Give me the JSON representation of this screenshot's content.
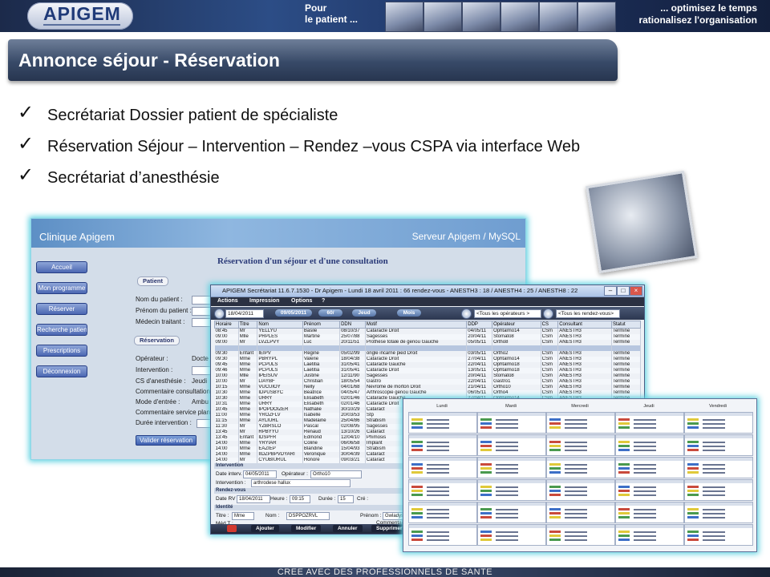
{
  "banner": {
    "logo_text": "APIGEM",
    "left_text": "Pour\nle patient ...",
    "right_text": "... optimisez le temps\nrationalisez l'organisation"
  },
  "slide": {
    "title": "Annonce séjour - Réservation",
    "bullets": [
      "Secrétariat  Dossier patient de spécialiste",
      "Réservation Séjour – Intervention – Rendez –vous CSPA via interface Web",
      "Secrétariat  d’anesthésie"
    ],
    "check_glyph": "✓"
  },
  "web_interface": {
    "clinic": "Clinique Apigem",
    "server": "Serveur Apigem / MySQL",
    "nav": [
      "Accueil",
      "Mon programme",
      "Réserver",
      "Recherche patient",
      "Prescriptions",
      "Déconnexion"
    ],
    "panel_title": "Réservation d'un séjour et d'une consultation",
    "section_patient": "Patient",
    "labels_patient": [
      "Nom du patient :",
      "Prénom du patient :",
      "Médecin traitant :"
    ],
    "section_reservation": "Réservation",
    "labels_reservation": [
      "Opérateur :",
      "Intervention :",
      "CS d'anesthésie :",
      "Commentaire consultation",
      "Mode d'entrée :",
      "Commentaire service planni",
      "Durée intervention :"
    ],
    "values": [
      "Docte",
      "Jeudi",
      "Ambu"
    ],
    "validate_button": "Valider réservation"
  },
  "secretariat": {
    "title": "APIGEM Secrétariat 11.6.7.1530 - Dr Apigem - Lundi 18 avril 2011 : 66 rendez-vous - ANESTH3 : 18 / ANESTH4 : 25 / ANESTH8 : 22",
    "window_controls": [
      "–",
      "□",
      "×"
    ],
    "menu": [
      "Actions",
      "Impression",
      "Options",
      "?"
    ],
    "toolbar": {
      "date_from": "18/04/2011",
      "date_to": "09/05/2011",
      "btn_1": "60/",
      "btn_2": "Jeud",
      "btn_3": "Mois",
      "operateurs": "<Tous les opérateurs >",
      "rendezvous": "<Tous les rendez-vous>"
    },
    "columns": [
      "Horaire",
      "Titre",
      "Nom",
      "Prénom",
      "DDN",
      "Motif",
      "DDP",
      "Opérateur",
      "CS",
      "Consultant",
      "Statut"
    ],
    "rows": [
      [
        "08:45",
        "Mr",
        "YELLYU",
        "Basile",
        "08/10/37",
        "Cataracte Droit",
        "04/05/11",
        "Ophtalmo14",
        "CSm",
        "ANESTH3",
        "Terminé"
      ],
      [
        "09:00",
        "Mlle",
        "PRPLES",
        "Martine",
        "25/07/88",
        "Sagesses",
        "20/04/11",
        "Stomato8",
        "CSm",
        "ANESTH3",
        "Terminé"
      ],
      [
        "09:00",
        "Mr",
        "LVZLPVY",
        "Luc",
        "20/11/51",
        "Prothèse totale de genou Gauche",
        "05/05/11",
        "Ortho8",
        "CSm",
        "ANESTH3",
        "Terminé"
      ],
      [
        "",
        "",
        "",
        "",
        "",
        "",
        "",
        "",
        "",
        "",
        ""
      ],
      [
        "09:30",
        "Enfant",
        "IEIPV",
        "Regine",
        "05/02/99",
        "ongle incarné pied Droit",
        "03/05/11",
        "Ortho2",
        "CSm",
        "ANESTH3",
        "Terminé"
      ],
      [
        "09:30",
        "Mme",
        "PBRYPL",
        "Valerie",
        "18/04/38",
        "Cataracte Droit",
        "27/04/11",
        "Ophtalmo14",
        "CSm",
        "ANESTH3",
        "Terminé"
      ],
      [
        "09:45",
        "Mme",
        "PCPULS",
        "Laetitia",
        "31/05/41",
        "Cataracte Gauche",
        "22/04/11",
        "Ophtalmo18",
        "CSm",
        "ANESTH3",
        "Terminé"
      ],
      [
        "09:46",
        "Mme",
        "PCPULS",
        "Laetitia",
        "31/05/41",
        "Cataracte Droit",
        "13/05/11",
        "Ophtalmo18",
        "CSm",
        "ANESTH3",
        "Terminé"
      ],
      [
        "10:00",
        "Mlle",
        "IPEISUV",
        "Justine",
        "12/11/90",
        "Sagesses",
        "20/04/11",
        "Stomato8",
        "CSm",
        "ANESTH3",
        "Terminé"
      ],
      [
        "10:00",
        "Mr",
        "LIAYBF",
        "Christian",
        "18/05/54",
        "Gastro",
        "22/04/11",
        "Gastro1",
        "CSm",
        "ANESTH3",
        "Terminé"
      ],
      [
        "10:15",
        "Mme",
        "VUCUIOY",
        "Nelly",
        "04/01/68",
        "Nevrome de morton Droit",
        "21/04/11",
        "Ortho10",
        "CSm",
        "ANESTH3",
        "Terminé"
      ],
      [
        "10:30",
        "Mme",
        "IDPUSBYC",
        "Beatrice",
        "04/05/47",
        "Arthroscopie genou Gauche",
        "06/05/11",
        "Ortho4",
        "CSm",
        "ANESTH3",
        "Terminé"
      ],
      [
        "10:30",
        "Mme",
        "URRY",
        "Elisabeth",
        "02/01/46",
        "Cataracte Gauche",
        "27/04/11",
        "Ophtalmo14",
        "CSm",
        "ANESTH3",
        "Terminé"
      ],
      [
        "10:31",
        "Mme",
        "URRY",
        "Elisabeth",
        "02/01/46",
        "Cataracte Droit",
        "",
        "",
        "",
        "",
        ""
      ],
      [
        "10:45",
        "Mme",
        "IPOPDOIZER",
        "Nathalie",
        "30/10/29",
        "Cataract",
        "",
        "",
        "",
        "",
        ""
      ],
      [
        "11:00",
        "Mme",
        "YROZFLV",
        "Isabelle",
        "20/03/53",
        "Stp",
        "",
        "",
        "",
        "",
        ""
      ],
      [
        "11:15",
        "Mme",
        "AYLIURL",
        "Madelaine",
        "25/04/86",
        "Strabism",
        "",
        "",
        "",
        "",
        ""
      ],
      [
        "11:30",
        "Mr",
        "YZBRSLO",
        "Pascal",
        "02/08/95",
        "Sagesses",
        "",
        "",
        "",
        "",
        ""
      ],
      [
        "13:45",
        "Mr",
        "RPBYYU",
        "Renaud",
        "13/10/26",
        "Cataract",
        "",
        "",
        "",
        "",
        ""
      ],
      [
        "13:45",
        "Enfant",
        "IDSPFR",
        "Edmond",
        "12/04/10",
        "Phimosis",
        "",
        "",
        "",
        "",
        ""
      ],
      [
        "14:00",
        "Mme",
        "YRYIAR",
        "Coline",
        "06/06/58",
        "Implant",
        "",
        "",
        "",
        "",
        ""
      ],
      [
        "14:00",
        "Mme",
        "EAZIEP",
        "Blandine",
        "15/04/93",
        "Strabism",
        "",
        "",
        "",
        "",
        ""
      ],
      [
        "14:00",
        "Mme",
        "IIDZPBPVDYARI",
        "Veronique",
        "30/04/39",
        "Cataract",
        "",
        "",
        "",
        "",
        ""
      ],
      [
        "14:00",
        "Mr",
        "CYUBIURUL",
        "Honore",
        "09/03/21",
        "Cataract",
        "",
        "",
        "",
        "",
        ""
      ]
    ],
    "sections": {
      "intervention": "Intervention",
      "rendezvous": "Rendez-vous",
      "identite": "Identité"
    },
    "detail": {
      "date_interv_label": "Date interv. :",
      "date_interv": "04/05/2011",
      "operateur_label": "Opérateur :",
      "operateur": "Ortho10",
      "intervention_label": "Intervention :",
      "intervention": "arthrodese hallux",
      "date_rv_label": "Date RV :",
      "date_rv": "18/04/2011",
      "heure_label": "Heure :",
      "heure": "09:15",
      "duree_label": "Durée :",
      "duree": "15",
      "cre_label": "Cré :",
      "titre_label": "Titre :",
      "titre": "Mme",
      "nom_label": "Nom :",
      "nom": "DSPPOZRVL",
      "prenom_label": "Prénom :",
      "prenom": "Gwladys",
      "med_label": "Méd T :",
      "comment_label": "Commentaires"
    },
    "bottom_buttons": [
      "Ajouter",
      "Modifier",
      "Annuler",
      "Supprimer"
    ]
  },
  "planning": {
    "days": [
      "Lundi",
      "Mardi",
      "Mercredi",
      "Jeudi",
      "Vendredi"
    ],
    "row_colors": [
      "#e0c93a",
      "#4a9a4e",
      "#3d6fc7",
      "#c94a3c"
    ]
  },
  "footer": {
    "text": "CREE AVEC DES PROFESSIONNELS DE SANTE"
  }
}
